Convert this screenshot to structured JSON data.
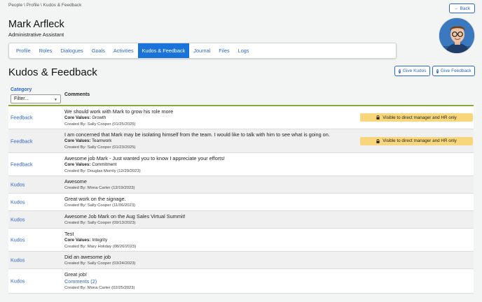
{
  "breadcrumb": "People \\ Profile \\ Kudos & Feedback",
  "back_label": "Back",
  "person": {
    "name": "Mark Arfleck",
    "title": "Administrative Assistant"
  },
  "tabs": [
    {
      "label": "Profile",
      "active": false
    },
    {
      "label": "Roles",
      "active": false
    },
    {
      "label": "Dialogues",
      "active": false
    },
    {
      "label": "Goals",
      "active": false
    },
    {
      "label": "Activities",
      "active": false
    },
    {
      "label": "Kudos & Feedback",
      "active": true
    },
    {
      "label": "Journal",
      "active": false
    },
    {
      "label": "Files",
      "active": false
    },
    {
      "label": "Logs",
      "active": false
    }
  ],
  "section_title": "Kudos & Feedback",
  "buttons": {
    "give_kudos": "Give Kudos",
    "give_feedback": "Give Feedback"
  },
  "table": {
    "category_header": "Category",
    "filter_placeholder": "Filter...",
    "comments_header": "Comments",
    "visibility_text": "Visible to direct manager and HR only",
    "rows": [
      {
        "category": "Feedback",
        "comment": "We should work with Mark to grow his role more",
        "core_values_label": "Core Values:",
        "core_values": "Growth",
        "created_by": "Created By: Sally Cooper (01/25/2025)",
        "visibility": true
      },
      {
        "category": "Feedback",
        "comment": "I am concerned that Mark may be isolating himself from the team. I would like to talk with him to see what is going on.",
        "core_values_label": "Core Values:",
        "core_values": "Teamwork",
        "created_by": "Created By: Sally Cooper (01/23/2025)",
        "visibility": true
      },
      {
        "category": "Feedback",
        "comment": "Awesome job Mark - Just wanted you to know I appreciate your efforts!",
        "core_values_label": "Core Values:",
        "core_values": "Commitment",
        "created_by": "Created By: Douglas Morrily (12/29/2023)",
        "visibility": false
      },
      {
        "category": "Kudos",
        "comment": "Awesome",
        "core_values_label": "",
        "core_values": "",
        "created_by": "Created By: Mona Carter (12/19/2023)",
        "visibility": false
      },
      {
        "category": "Kudos",
        "comment": "Great work on the signage.",
        "core_values_label": "",
        "core_values": "",
        "created_by": "Created By: Sally Cooper (11/06/2023)",
        "visibility": false
      },
      {
        "category": "Kudos",
        "comment": "Awesome Job Mark on the Aug Sales Virtual Summit!",
        "core_values_label": "",
        "core_values": "",
        "created_by": "Created By: Sally Cooper (09/13/2023)",
        "visibility": false
      },
      {
        "category": "Kudos",
        "comment": "Test",
        "core_values_label": "Core Values:",
        "core_values": "Integrity",
        "created_by": "Created By: Mary Holiday (08/26/2023)",
        "visibility": false
      },
      {
        "category": "Kudos",
        "comment": "Did an awesome job",
        "core_values_label": "",
        "core_values": "",
        "created_by": "Created By: Sally Cooper (03/24/2023)",
        "visibility": false
      },
      {
        "category": "Kudos",
        "comment": "Great job!",
        "comments_link": "Comments (2)",
        "core_values_label": "",
        "core_values": "",
        "created_by": "Created By: Mona Carter (02/25/2023)",
        "visibility": false
      }
    ]
  },
  "colors": {
    "accent": "#1a73d9",
    "link": "#2b66c8",
    "visibility_badge": "#f8d77c",
    "header_rule": "#8aa83a"
  }
}
